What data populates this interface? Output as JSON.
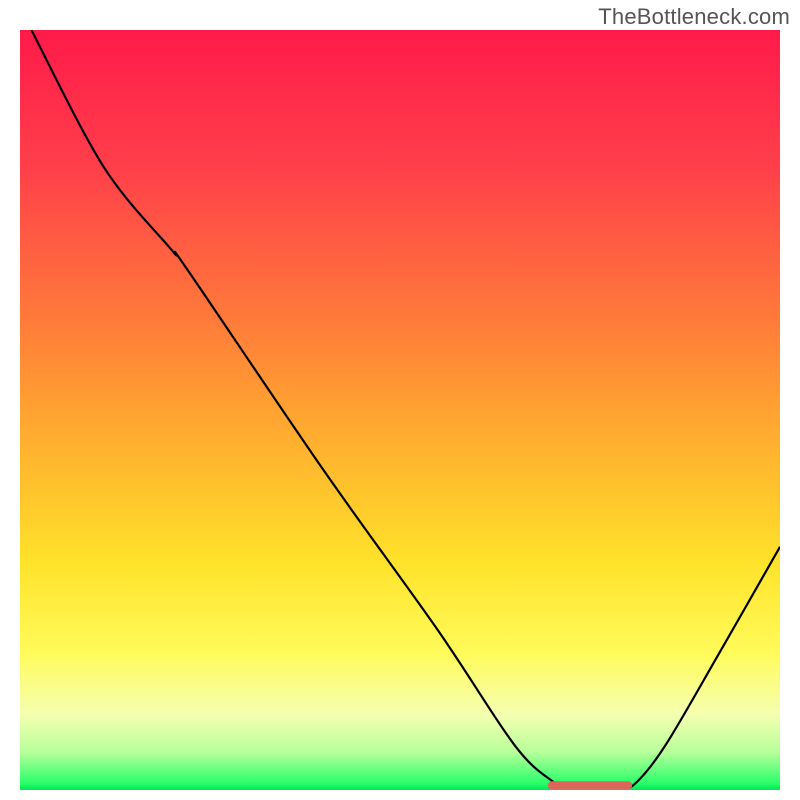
{
  "watermark": "TheBottleneck.com",
  "chart_data": {
    "type": "line",
    "title": "",
    "xlabel": "",
    "ylabel": "",
    "xlim": [
      0,
      100
    ],
    "ylim": [
      0,
      100
    ],
    "gradient_stops": [
      {
        "offset": 0,
        "color": "#ff1a4a"
      },
      {
        "offset": 18,
        "color": "#ff3f4a"
      },
      {
        "offset": 38,
        "color": "#ff7a3a"
      },
      {
        "offset": 55,
        "color": "#ffb22e"
      },
      {
        "offset": 70,
        "color": "#ffe22a"
      },
      {
        "offset": 82,
        "color": "#fffb5a"
      },
      {
        "offset": 90,
        "color": "#f5ffb0"
      },
      {
        "offset": 95,
        "color": "#b8ff9a"
      },
      {
        "offset": 99,
        "color": "#2eff6a"
      },
      {
        "offset": 100,
        "color": "#00e858"
      }
    ],
    "series": [
      {
        "name": "bottleneck-curve",
        "color": "#000000",
        "points": [
          {
            "x": 1.5,
            "y": 100
          },
          {
            "x": 11,
            "y": 82
          },
          {
            "x": 20,
            "y": 71
          },
          {
            "x": 22,
            "y": 68.5
          },
          {
            "x": 40,
            "y": 42
          },
          {
            "x": 55,
            "y": 21
          },
          {
            "x": 65,
            "y": 6
          },
          {
            "x": 70,
            "y": 1.2
          },
          {
            "x": 72,
            "y": 0.5
          },
          {
            "x": 79,
            "y": 0.5
          },
          {
            "x": 81,
            "y": 0.9
          },
          {
            "x": 85,
            "y": 6
          },
          {
            "x": 92,
            "y": 18
          },
          {
            "x": 100,
            "y": 32
          }
        ]
      }
    ],
    "marker": {
      "name": "optimal-range",
      "color": "#d9675a",
      "x_start": 70,
      "x_end": 80,
      "y": 0.6,
      "thickness": 1.1
    }
  }
}
